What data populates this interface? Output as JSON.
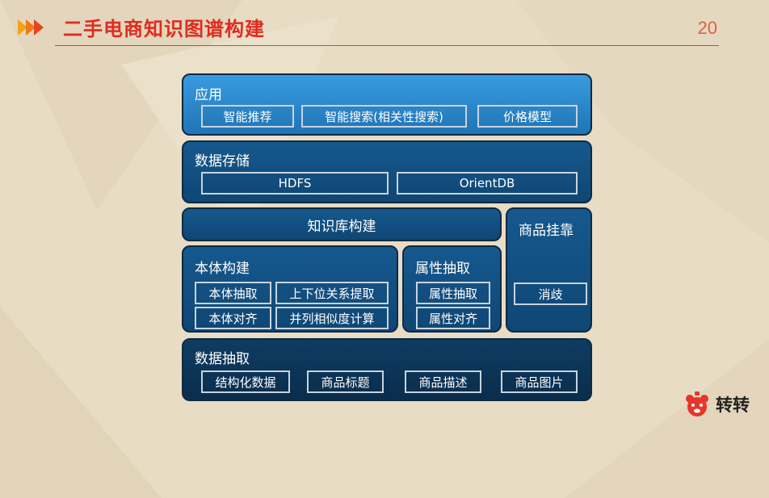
{
  "header": {
    "title": "二手电商知识图谱构建",
    "page_number": "20"
  },
  "diagram": {
    "application": {
      "label": "应用",
      "items": [
        "智能推荐",
        "智能搜索(相关性搜索)",
        "价格模型"
      ]
    },
    "storage": {
      "label": "数据存储",
      "items": [
        "HDFS",
        "OrientDB"
      ]
    },
    "kb_build": {
      "label": "知识库构建"
    },
    "product_linking": {
      "label": "商品挂靠",
      "items": [
        "消歧"
      ]
    },
    "ontology": {
      "label": "本体构建",
      "items": [
        "本体抽取",
        "上下位关系提取",
        "本体对齐",
        "并列相似度计算"
      ]
    },
    "attribute": {
      "label": "属性抽取",
      "items": [
        "属性抽取",
        "属性对齐"
      ]
    },
    "extraction": {
      "label": "数据抽取",
      "items": [
        "结构化数据",
        "商品标题",
        "商品描述",
        "商品图片"
      ]
    }
  },
  "brand": {
    "logo_text": "转转"
  },
  "colors": {
    "title": "#e22b1f",
    "app_panel": "#2b8ad0",
    "dark_panel": "#114a78",
    "bottom_panel": "#0c3456",
    "background": "#e8dcc4"
  }
}
